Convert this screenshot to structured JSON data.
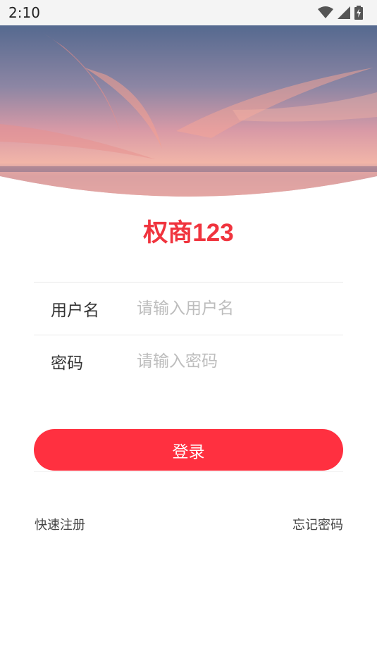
{
  "status_bar": {
    "time": "2:10"
  },
  "app": {
    "title": "权商123"
  },
  "form": {
    "username": {
      "label": "用户名",
      "placeholder": "请输入用户名",
      "value": ""
    },
    "password": {
      "label": "密码",
      "placeholder": "请输入密码",
      "value": ""
    }
  },
  "actions": {
    "login_label": "登录",
    "register_label": "快速注册",
    "forgot_label": "忘记密码"
  },
  "colors": {
    "accent": "#ff3040",
    "title": "#f0343e"
  },
  "icons": [
    "wifi-icon",
    "cell-signal-icon",
    "battery-charging-icon"
  ]
}
